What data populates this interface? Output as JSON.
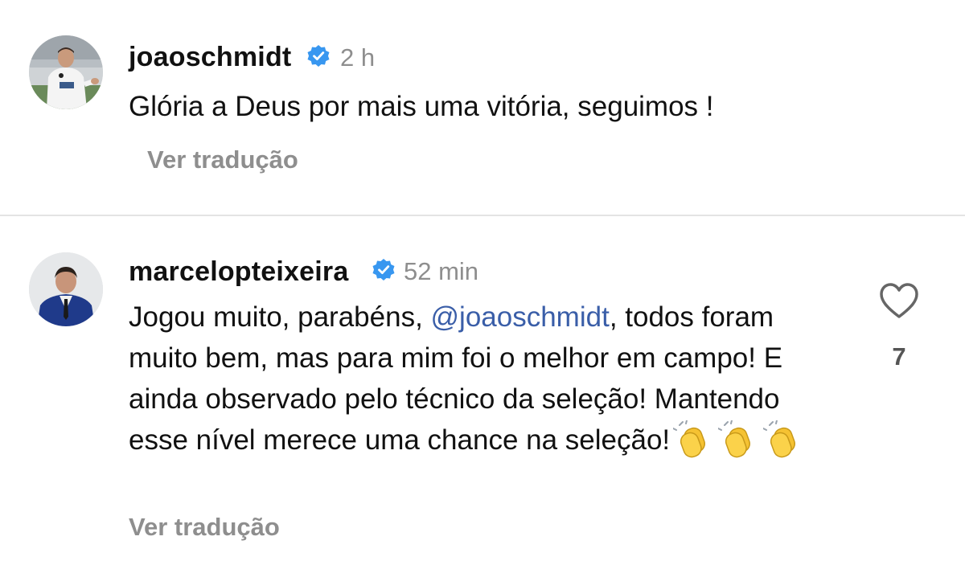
{
  "comments": [
    {
      "username": "joaoschmidt",
      "verified": true,
      "time": "2 h",
      "text": "Glória a Deus por mais uma vitória, seguimos !",
      "translate_label": "Ver tradução",
      "avatar_icon": "player-photo-avatar"
    },
    {
      "username": "marcelopteixeira",
      "verified": true,
      "time": "52 min",
      "text_before_mention": "Jogou muito, parabéns, ",
      "mention": "@joaoschmidt",
      "text_after_mention": ", todos foram muito bem, mas para mim foi o melhor em campo! E ainda observado pelo técnico da seleção! Mantendo esse nível merece uma chance na seleção!",
      "emojis": [
        "👏",
        "👏",
        "👏"
      ],
      "translate_label": "Ver tradução",
      "like_count": "7",
      "like_icon": "heart-outline-icon",
      "avatar_icon": "businessman-photo-avatar"
    }
  ],
  "colors": {
    "verified_badge": "#3897f0",
    "mention": "#3a5ea8",
    "secondary_text": "#8e8e8e",
    "divider": "#e4e4e4"
  }
}
